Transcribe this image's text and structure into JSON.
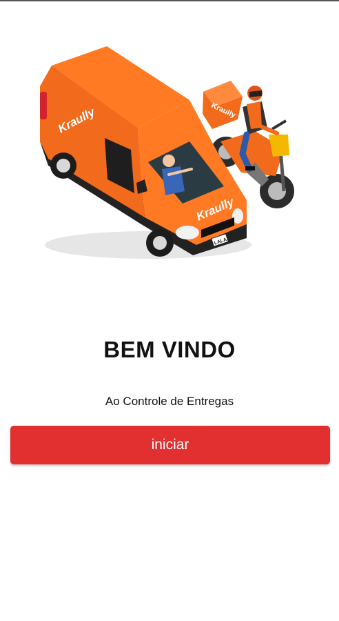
{
  "hero": {
    "brand_text": "Kraully",
    "plate_text": "LALA",
    "illustration_icon": "delivery-van-and-motorcycle-icon"
  },
  "welcome": {
    "title": "BEM VINDO",
    "subtitle": "Ao Controle de Entregas"
  },
  "start_button": {
    "label": "iniciar"
  },
  "colors": {
    "accent": "#e1302f",
    "brand_orange": "#f26a1b",
    "text": "#111111",
    "background": "#ffffff"
  }
}
